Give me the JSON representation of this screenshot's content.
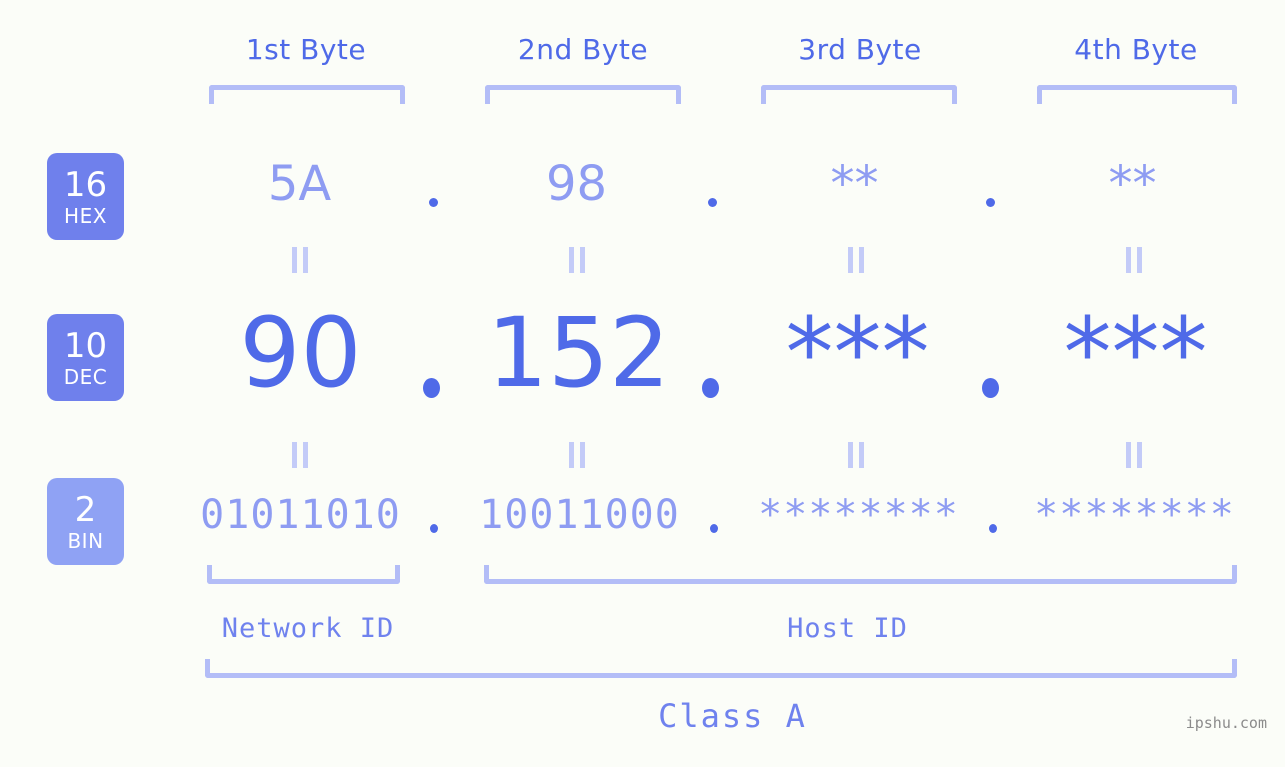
{
  "meta": {
    "background": "#fbfdf8",
    "accent": "#4f6ae8",
    "accent_light": "#8e9cf2",
    "bracket_color": "#b3bdf7",
    "badge_color": "#6f80ec",
    "badge_color_light": "#8fa2f4"
  },
  "byte_headers": [
    {
      "label": "1st Byte"
    },
    {
      "label": "2nd Byte"
    },
    {
      "label": "3rd Byte"
    },
    {
      "label": "4th Byte"
    }
  ],
  "bases": [
    {
      "num": "16",
      "name": "HEX"
    },
    {
      "num": "10",
      "name": "DEC"
    },
    {
      "num": "2",
      "name": "BIN"
    }
  ],
  "rows": {
    "hex": {
      "base_num": "16",
      "base_name": "HEX",
      "values": [
        "5A",
        "98",
        "**",
        "**"
      ],
      "separator": "."
    },
    "dec": {
      "base_num": "10",
      "base_name": "DEC",
      "values": [
        "90",
        "152",
        "***",
        "***"
      ],
      "separator": "."
    },
    "bin": {
      "base_num": "2",
      "base_name": "BIN",
      "values": [
        "01011010",
        "10011000",
        "********",
        "********"
      ],
      "separator": "."
    }
  },
  "footer": {
    "network_id_label": "Network ID",
    "host_id_label": "Host ID",
    "class_label": "Class A",
    "watermark": "ipshu.com"
  }
}
